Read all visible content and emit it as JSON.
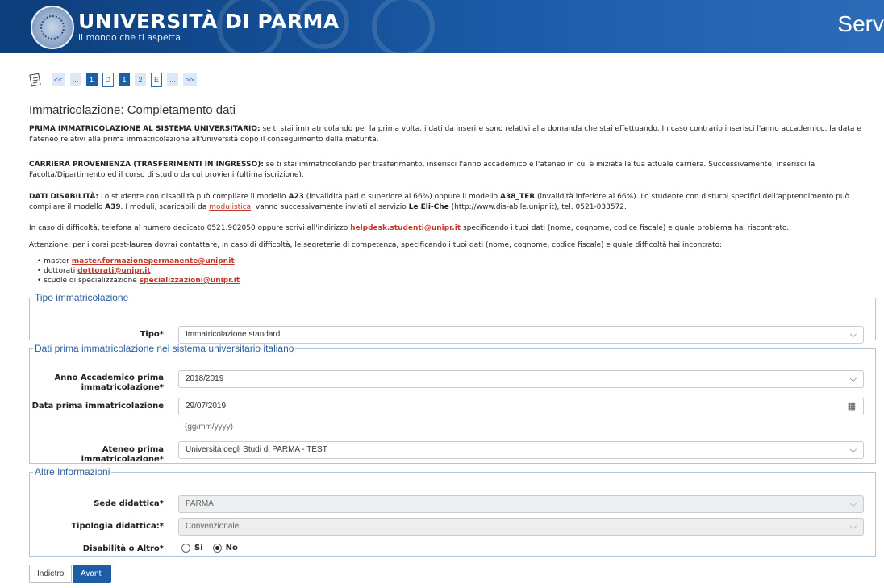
{
  "header": {
    "university_name": "UNIVERSITÀ DI PARMA",
    "tagline": "il mondo che ti aspetta",
    "right_text": "Serv"
  },
  "wizard": {
    "steps": [
      "<<",
      "...",
      "1",
      "D",
      "1",
      "2",
      "E",
      "...",
      ">>"
    ]
  },
  "page_title": "Immatricolazione: Completamento dati",
  "info": {
    "p1_bold": "PRIMA IMMATRICOLAZIONE AL SISTEMA UNIVERSITARIO:",
    "p1_text": " se ti stai immatricolando per la prima volta, i dati da inserire sono relativi alla domanda che stai effettuando. In caso contrario inserisci l'anno accademico, la data e l'ateneo relativi alla prima immatricolazione all'università dopo il conseguimento della maturità.",
    "p2_bold": "CARRIERA PROVENIENZA (TRASFERIMENTI IN INGRESSO):",
    "p2_text": " se ti stai immatricolando per trasferimento, inserisci l'anno accademico e l'ateneo in cui è iniziata la tua attuale carriera. Successivamente, inserisci la Facoltà/Dipartimento ed il corso di studio da cui provieni (ultima iscrizione).",
    "p3_bold": "DATI DISABILITÀ:",
    "p3_a": " Lo studente con disabilità può compilare il modello ",
    "p3_a23": "A23",
    "p3_b": " (invalidità pari o superiore al 66%) oppure il modello ",
    "p3_a38": "A38_TER",
    "p3_c": " (invalidità inferiore al 66%). Lo studente con disturbi specifici dell'apprendimento può compilare il modello ",
    "p3_a39": "A39",
    "p3_d": ". I moduli, scaricabili da ",
    "p3_link": "modulistica",
    "p3_e": ", vanno successivamente inviati al servizio ",
    "p3_service": "Le Eli-Che",
    "p3_f": " (http://www.dis-abile.unipr.it), tel. 0521-033572.",
    "p4_a": "In caso di difficoltà, telefona al numero dedicato 0521.902050 oppure scrivi all'indirizzo ",
    "p4_link": "helpdesk.studenti@unipr.it",
    "p4_b": " specificando i tuoi dati (nome, cognome, codice fiscale) e quale problema hai riscontrato.",
    "p5": "Attenzione: per i corsi post-laurea dovrai contattare, in caso di difficoltà, le segreterie di competenza, specificando i tuoi dati (nome, cognome, codice fiscale) e quale difficoltà hai incontrato:",
    "mails": [
      {
        "label": "master ",
        "email": "master.formazionepermanente@unipr.it"
      },
      {
        "label": "dottorati ",
        "email": "dottorati@unipr.it"
      },
      {
        "label": "scuole di specializzazione ",
        "email": "specializzazioni@unipr.it"
      }
    ]
  },
  "tipo_section": {
    "legend": "Tipo immatricolazione",
    "tipo_label": "Tipo*",
    "tipo_value": "Immatricolazione standard"
  },
  "prima_section": {
    "legend": "Dati prima immatricolazione nel sistema universitario italiano",
    "anno_label": "Anno Accademico prima immatricolazione*",
    "anno_value": "2018/2019",
    "data_label": "Data prima immatricolazione",
    "data_value": "29/07/2019",
    "data_hint": "(gg/mm/yyyy)",
    "ateneo_label": "Ateneo prima immatricolazione*",
    "ateneo_value": "Università degli Studi di PARMA - TEST"
  },
  "altre_section": {
    "legend": "Altre Informazioni",
    "sede_label": "Sede didattica*",
    "sede_value": "PARMA",
    "tipologia_label": "Tipologia didattica:*",
    "tipologia_value": "Convenzionale",
    "disab_label": "Disabilità o Altro*",
    "opt_si": "Si",
    "opt_no": "No",
    "selected": "No"
  },
  "buttons": {
    "back": "Indietro",
    "next": "Avanti"
  },
  "colors": {
    "header_blue": "#0d3d7a",
    "accent_blue": "#1e5ea6",
    "link_red": "#c0392b"
  }
}
